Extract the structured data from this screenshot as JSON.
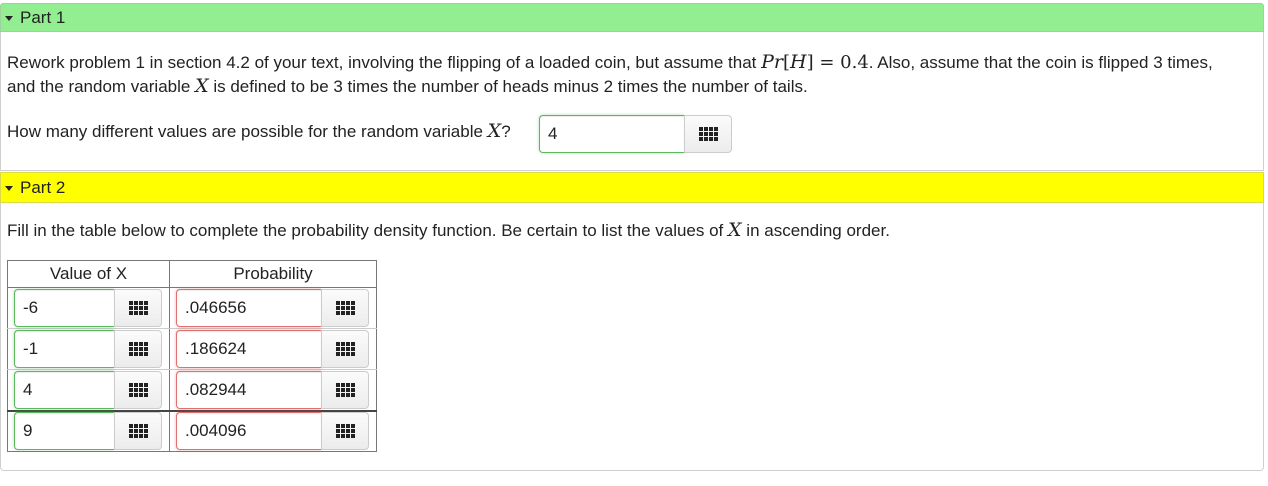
{
  "part1": {
    "header": "Part 1",
    "problem_intro": "Rework problem 1 in section 4.2 of your text, involving the flipping of a loaded coin, but assume that",
    "math_pr": "Pr",
    "math_h": "H",
    "math_eq": " = 0.4",
    "problem_rest": ". Also, assume that the coin is flipped 3 times,",
    "line2_start": "and the random variable",
    "math_x": "X",
    "line2_end": "is defined to be 3 times the number of heads minus 2 times the number of tails.",
    "question_start": "How many different values are possible for the random variable",
    "question_end": "?",
    "answer": "4"
  },
  "part2": {
    "header": "Part 2",
    "instruction_start": "Fill in the table below to complete the probability density function. Be certain to list the values of",
    "instruction_end": "in ascending order.",
    "table": {
      "col_headers": [
        "Value of X",
        "Probability"
      ],
      "rows": [
        {
          "value": "-6",
          "probability": ".046656"
        },
        {
          "value": "-1",
          "probability": ".186624"
        },
        {
          "value": "4",
          "probability": ".082944"
        },
        {
          "value": "9",
          "probability": ".004096"
        }
      ]
    }
  }
}
